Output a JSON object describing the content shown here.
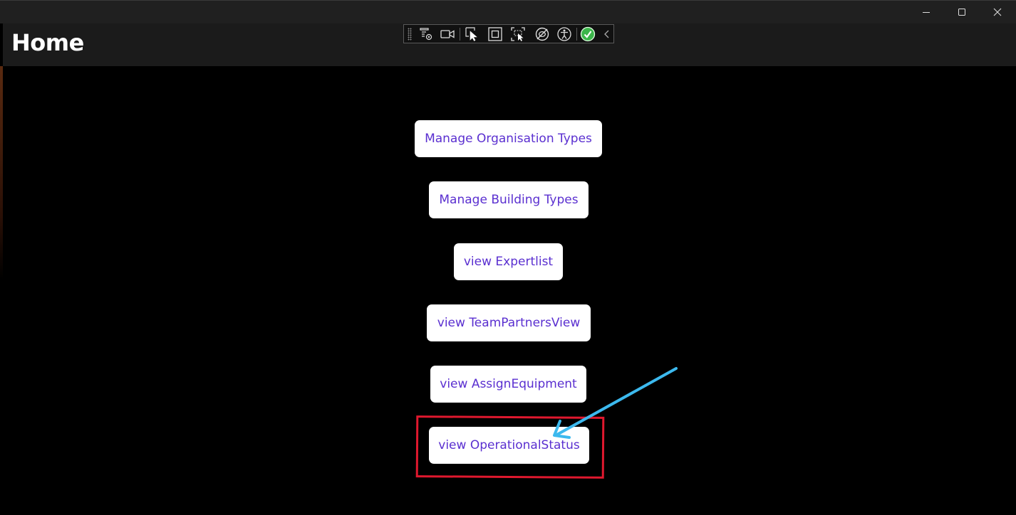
{
  "window": {
    "controls": {
      "minimize_icon": "minimize-icon",
      "maximize_icon": "maximize-icon",
      "close_icon": "close-icon"
    }
  },
  "header": {
    "title": "Home"
  },
  "debug_toolbar": {
    "icons": [
      "live-visual-tree-icon",
      "record-icon",
      "select-element-icon",
      "display-layout-adorners-icon",
      "track-focus-icon",
      "binding-failures-icon",
      "accessibility-checker-icon",
      "hot-reload-status-icon",
      "collapse-toolbar-icon"
    ]
  },
  "main": {
    "buttons": [
      {
        "label": "Manage Organisation Types"
      },
      {
        "label": "Manage Building Types"
      },
      {
        "label": "view Expertlist"
      },
      {
        "label": "view TeamPartnersView"
      },
      {
        "label": "view AssignEquipment"
      },
      {
        "label": "view OperationalStatus"
      }
    ]
  },
  "annotation": {
    "highlight_color": "#e0182e",
    "arrow_color": "#3cb9ee"
  },
  "colors": {
    "button_text": "#5a2fd0",
    "button_bg": "#ffffff",
    "page_bg": "#000000",
    "header_bg": "#1b1b1b",
    "hot_reload_ok": "#3bb54a"
  }
}
